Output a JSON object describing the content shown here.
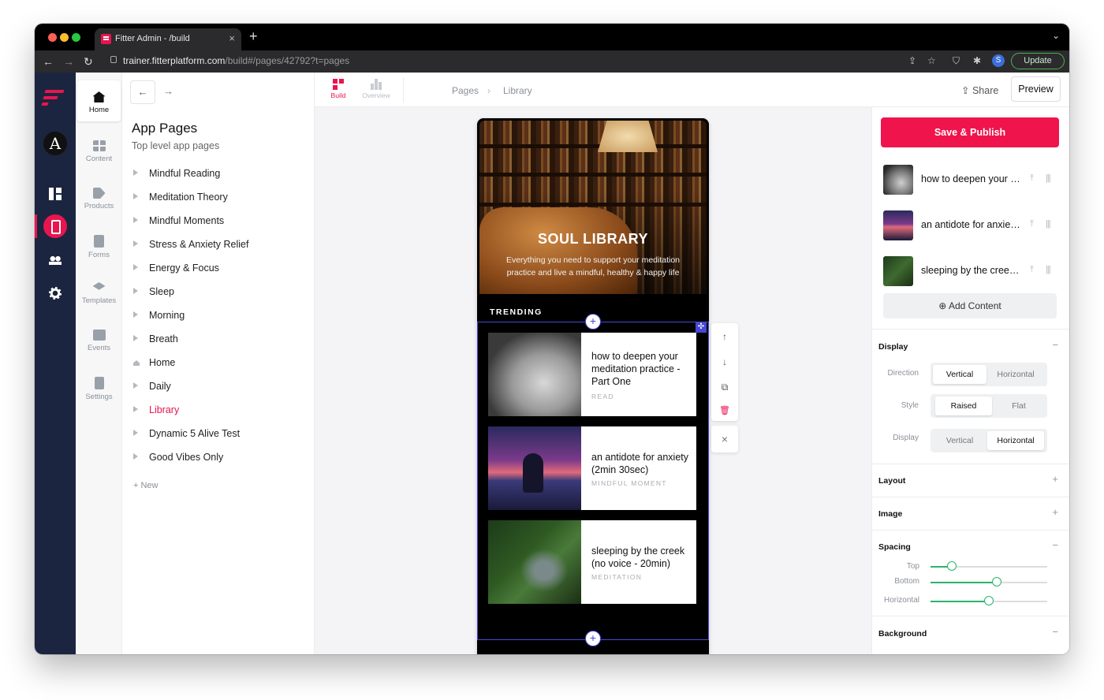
{
  "browser": {
    "tab_title": "Fitter Admin - /build",
    "tab_close": "×",
    "new_tab": "+",
    "tab_menu": "⌄",
    "url_host": "trainer.fitterplatform.com",
    "url_path": "/build#/pages/42792?t=pages",
    "avatar_letter": "S",
    "update_label": "Update",
    "nav": {
      "back": "←",
      "forward": "→",
      "reload": "↻"
    },
    "ext_icons": [
      "⇪",
      "☆",
      "⛉",
      "✱"
    ],
    "menu_dots": "⋮"
  },
  "rail": {
    "account_letter": "A"
  },
  "sub_nav": [
    {
      "label": "Home",
      "active": true
    },
    {
      "label": "Content"
    },
    {
      "label": "Products"
    },
    {
      "label": "Forms"
    },
    {
      "label": "Templates"
    },
    {
      "label": "Events"
    },
    {
      "label": "Settings"
    }
  ],
  "pages_panel": {
    "back": "←",
    "forward": "→",
    "title": "App Pages",
    "subtitle": "Top level app pages",
    "items": [
      {
        "label": "Mindful Reading"
      },
      {
        "label": "Meditation Theory"
      },
      {
        "label": "Mindful Moments"
      },
      {
        "label": "Stress & Anxiety Relief"
      },
      {
        "label": "Energy & Focus"
      },
      {
        "label": "Sleep"
      },
      {
        "label": "Morning"
      },
      {
        "label": "Breath"
      },
      {
        "label": "Home",
        "home": true
      },
      {
        "label": "Daily"
      },
      {
        "label": "Library",
        "active": true
      },
      {
        "label": "Dynamic 5 Alive Test"
      },
      {
        "label": "Good Vibes Only"
      }
    ],
    "new_label": "+  New"
  },
  "topbar": {
    "build_label": "Build",
    "overview_label": "Overview",
    "breadcrumb": [
      "Pages",
      "›",
      "Library"
    ],
    "share_label": "⇪  Share",
    "preview_label": "Preview"
  },
  "preview": {
    "hero_title": "SOUL LIBRARY",
    "hero_text": "Everything you need to support your meditation practice and live a mindful, healthy & happy life",
    "section_label": "TRENDING",
    "plus": "+",
    "move": "✣",
    "cards": [
      {
        "title": "how to deepen your meditation practice - Part One",
        "tag": "READ"
      },
      {
        "title": "an antidote for anxiety (2min 30sec)",
        "tag": "MINDFUL MOMENT"
      },
      {
        "title": "sleeping by the creek (no voice - 20min)",
        "tag": "MEDITATION"
      }
    ],
    "tools": [
      "↑",
      "↓",
      "⧉",
      "🗑"
    ],
    "close": "×"
  },
  "right_panel": {
    "save_label": "Save & Publish",
    "content_items": [
      {
        "label": "how to deepen your meditation practice - Part One"
      },
      {
        "label": "an antidote for anxiety (2min 30sec)"
      },
      {
        "label": "sleeping by the creek (no voice - 20min)"
      }
    ],
    "pin": "⤒",
    "drag": "|||",
    "add_content_label": "⊕ Add Content",
    "display": {
      "title": "Display",
      "toggle": "−",
      "direction_label": "Direction",
      "direction_options": [
        "Vertical",
        "Horizontal"
      ],
      "style_label": "Style",
      "style_options": [
        "Raised",
        "Flat"
      ],
      "display_label": "Display",
      "display_options": [
        "Vertical",
        "Horizontal"
      ]
    },
    "layout": {
      "title": "Layout",
      "toggle": "+"
    },
    "image": {
      "title": "Image",
      "toggle": "+"
    },
    "spacing": {
      "title": "Spacing",
      "toggle": "−",
      "top_label": "Top",
      "top_value": 0.18,
      "bottom_label": "Bottom",
      "bottom_value": 0.57,
      "horizontal_label": "Horizontal",
      "horizontal_value": 0.5
    },
    "background": {
      "title": "Background",
      "toggle": "−"
    }
  },
  "colors": {
    "accent": "#e8154f",
    "rail": "#1b2540",
    "selection": "#4646d8",
    "slider": "#28b46a"
  }
}
